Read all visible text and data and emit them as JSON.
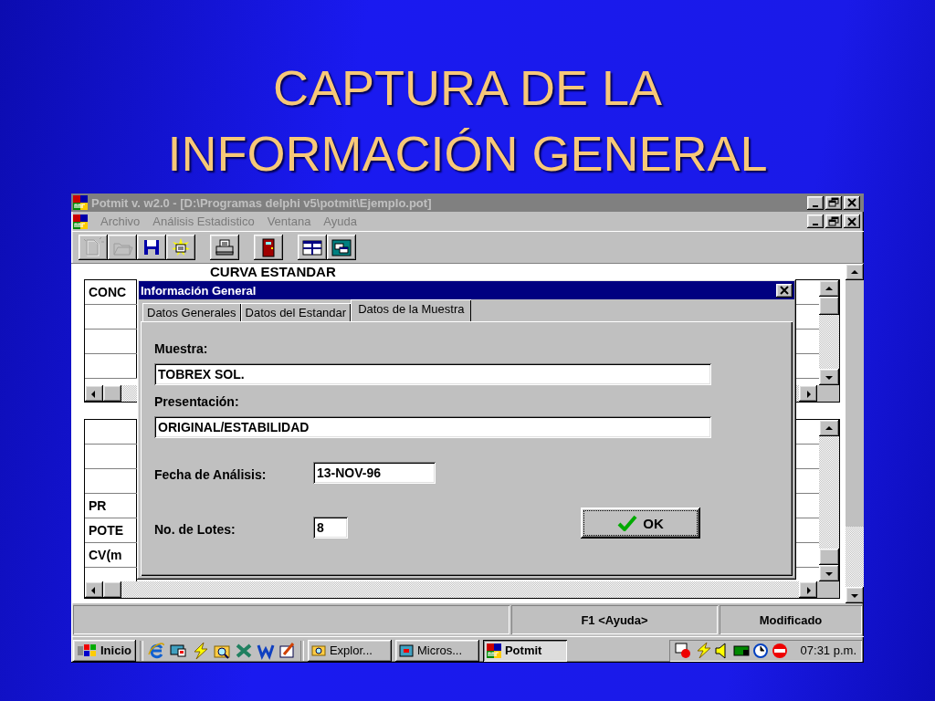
{
  "slide": {
    "title": [
      "CAPTURA DE LA",
      "INFORMACIÓN GENERAL"
    ]
  },
  "window": {
    "title": "Potmit v. w2.0 - [D:\\Programas delphi v5\\potmit\\Ejemplo.pot]",
    "active": false
  },
  "menu": [
    {
      "label": "Archivo",
      "disabled": true
    },
    {
      "label": "Análisis Estadistico",
      "disabled": true
    },
    {
      "label": "Ventana",
      "disabled": true
    },
    {
      "label": "Ayuda",
      "disabled": true
    }
  ],
  "toolbar": [
    [
      {
        "kind": "new",
        "disabled": true
      },
      {
        "kind": "open",
        "disabled": true
      },
      {
        "kind": "save",
        "disabled": false
      },
      {
        "kind": "wizard",
        "disabled": false
      }
    ],
    [
      {
        "kind": "print",
        "disabled": false
      }
    ],
    [
      {
        "kind": "exit",
        "disabled": false
      }
    ],
    [
      {
        "kind": "tile",
        "disabled": false
      },
      {
        "kind": "cascade",
        "disabled": false
      }
    ]
  ],
  "document": {
    "heading": "CURVA ESTANDAR",
    "grids": [
      {
        "rows": [
          {
            "kind": "text",
            "label": "CONC"
          },
          {
            "kind": "blank"
          },
          {
            "kind": "blank"
          },
          {
            "kind": "blank"
          }
        ]
      },
      {
        "rows": [
          {
            "kind": "blank"
          },
          {
            "kind": "blank"
          },
          {
            "kind": "blank"
          },
          {
            "kind": "text",
            "label": "PR"
          },
          {
            "kind": "text",
            "label": "POTE"
          },
          {
            "kind": "text",
            "label": "CV(m"
          },
          {
            "kind": "blank"
          }
        ]
      }
    ]
  },
  "dialog": {
    "title": "Información General",
    "tabs": [
      {
        "label": "Datos Generales",
        "selected": false
      },
      {
        "label": "Datos del Estandar",
        "selected": false
      },
      {
        "label": "Datos de la Muestra",
        "selected": true
      }
    ],
    "fields": [
      {
        "kind": "wide",
        "label": "Muestra:",
        "value": "TOBREX SOL."
      },
      {
        "kind": "wide",
        "label": "Presentación:",
        "value": "ORIGINAL/ESTABILIDAD"
      },
      {
        "kind": "date",
        "label": "Fecha de Análisis:",
        "value": "13-NOV-96"
      },
      {
        "kind": "short",
        "label": "No. de Lotes:",
        "value": "8"
      }
    ],
    "ok_button": "OK"
  },
  "status_bar": {
    "panels": [
      "F1 <Ayuda>",
      "Modificado"
    ]
  },
  "taskbar": {
    "start": "Inicio",
    "tasks": [
      {
        "label": "Explor...",
        "selected": false
      },
      {
        "label": "Micros...",
        "selected": false
      },
      {
        "label": "Potmit",
        "selected": true
      }
    ],
    "clock": "07:31 p.m."
  }
}
